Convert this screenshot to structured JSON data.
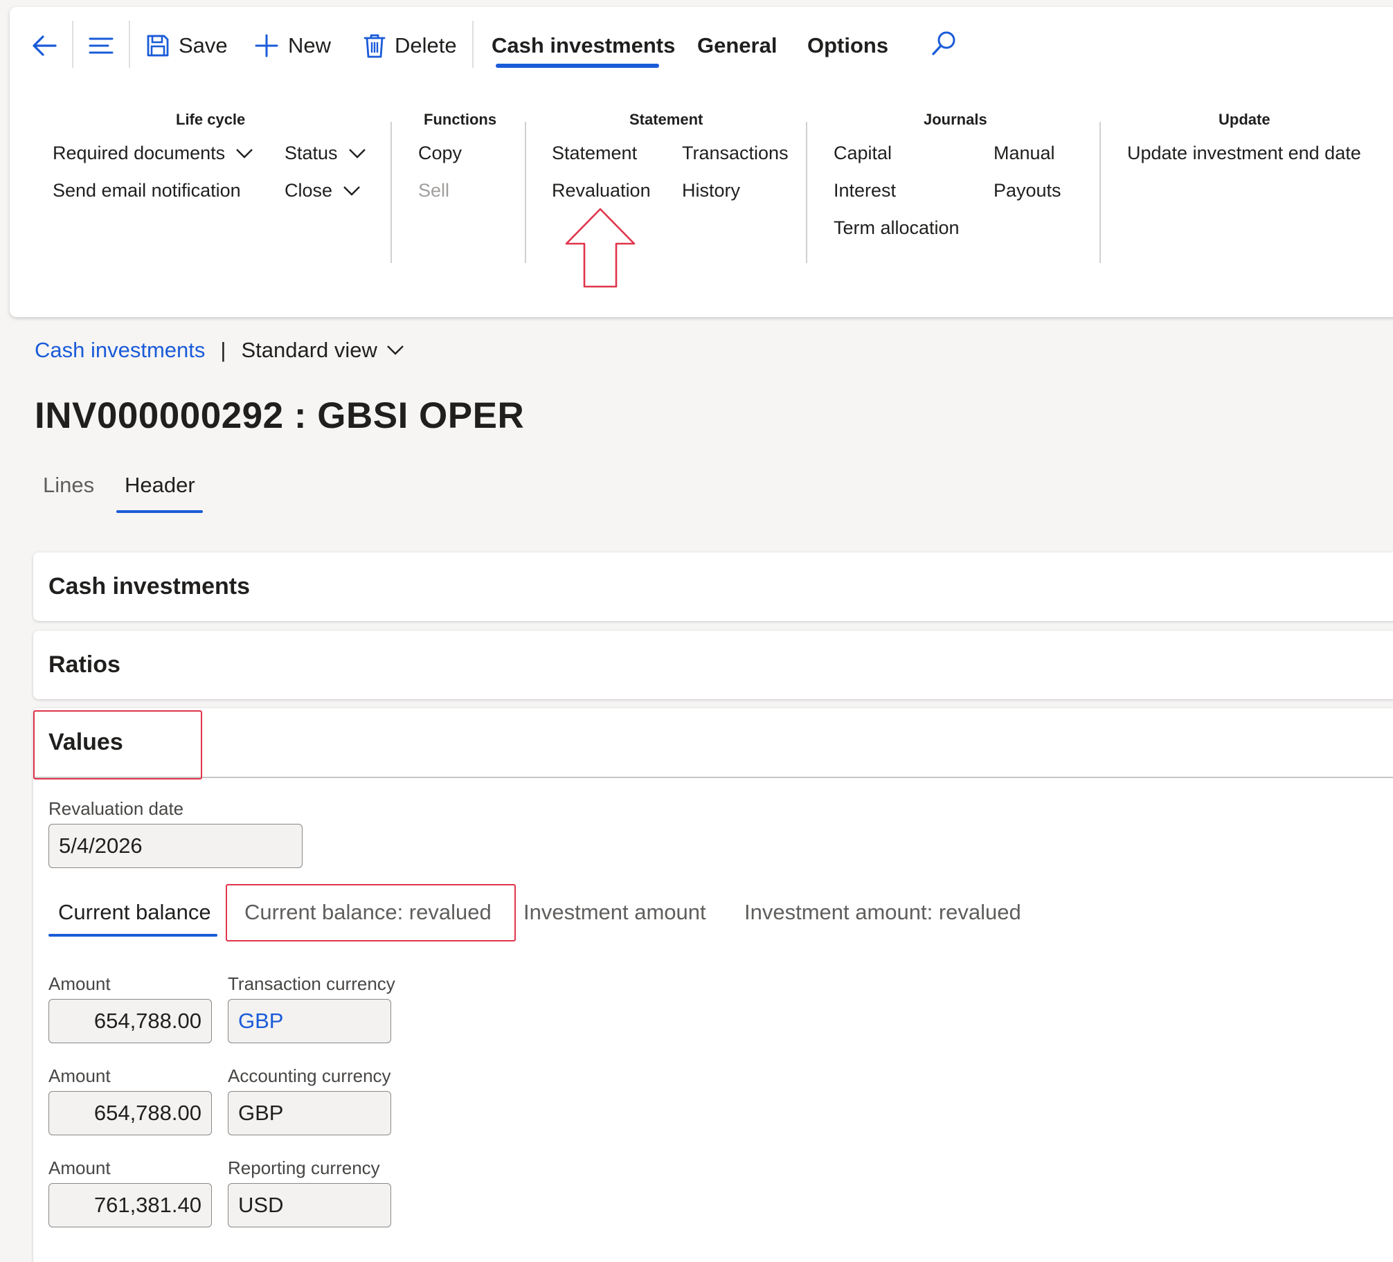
{
  "toolbar": {
    "save_label": "Save",
    "new_label": "New",
    "delete_label": "Delete"
  },
  "ribbon_tabs": {
    "cash_investments": "Cash investments",
    "general": "General",
    "options": "Options"
  },
  "groups": {
    "life_cycle": {
      "title": "Life cycle",
      "required_documents": "Required documents",
      "send_email": "Send email notification",
      "status": "Status",
      "close": "Close"
    },
    "functions": {
      "title": "Functions",
      "copy": "Copy",
      "sell": "Sell"
    },
    "statement": {
      "title": "Statement",
      "statement": "Statement",
      "revaluation": "Revaluation",
      "transactions": "Transactions",
      "history": "History"
    },
    "journals": {
      "title": "Journals",
      "capital": "Capital",
      "interest": "Interest",
      "term_allocation": "Term allocation",
      "manual": "Manual",
      "payouts": "Payouts"
    },
    "update": {
      "title": "Update",
      "update_end_date": "Update investment end date"
    }
  },
  "breadcrumb": {
    "link": "Cash investments",
    "separator": "|",
    "view": "Standard view"
  },
  "page_title": "INV000000292 : GBSI OPER",
  "page_tabs": {
    "lines": "Lines",
    "header": "Header"
  },
  "sections": {
    "cash_investments": "Cash investments",
    "ratios": "Ratios",
    "values": "Values"
  },
  "values": {
    "revaluation_date_label": "Revaluation date",
    "revaluation_date": "5/4/2026",
    "subtabs": {
      "current_balance": "Current balance",
      "current_balance_revalued": "Current balance: revalued",
      "investment_amount": "Investment amount",
      "investment_amount_revalued": "Investment amount: revalued"
    },
    "rows": [
      {
        "amount_label": "Amount",
        "amount": "654,788.00",
        "currency_label": "Transaction currency",
        "currency": "GBP"
      },
      {
        "amount_label": "Amount",
        "amount": "654,788.00",
        "currency_label": "Accounting currency",
        "currency": "GBP"
      },
      {
        "amount_label": "Amount",
        "amount": "761,381.40",
        "currency_label": "Reporting currency",
        "currency": "USD"
      }
    ]
  },
  "colors": {
    "accent": "#1a5bd8",
    "link": "#1a5bd8",
    "annotation": "#e0344c"
  }
}
